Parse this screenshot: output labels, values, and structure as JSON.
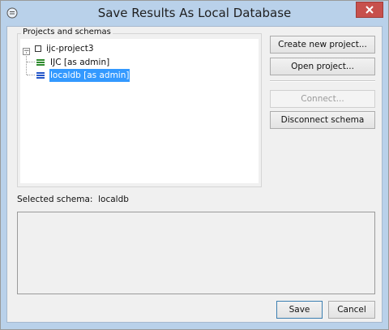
{
  "window": {
    "title": "Save Results As Local Database",
    "icons": {
      "app": "app-icon",
      "close": "close-icon"
    },
    "close_color": "#c7504c"
  },
  "projects_group": {
    "label": "Projects and schemas",
    "tree": {
      "project": {
        "label": "ijc-project3",
        "expanded": true
      },
      "schemas": [
        {
          "label": "IJC [as admin]",
          "selected": false,
          "icon_color": "#2e8b2e"
        },
        {
          "label": "localdb [as admin]",
          "selected": true,
          "icon_color": "#2456c8"
        }
      ]
    }
  },
  "buttons": {
    "create": "Create new project...",
    "open": "Open project...",
    "connect": "Connect...",
    "disconnect": "Disconnect schema",
    "save": "Save",
    "cancel": "Cancel"
  },
  "selected_schema": {
    "label": "Selected schema:",
    "value": "localdb"
  },
  "colors": {
    "selection": "#3399ff",
    "titlebar": "#b9d1ea"
  }
}
